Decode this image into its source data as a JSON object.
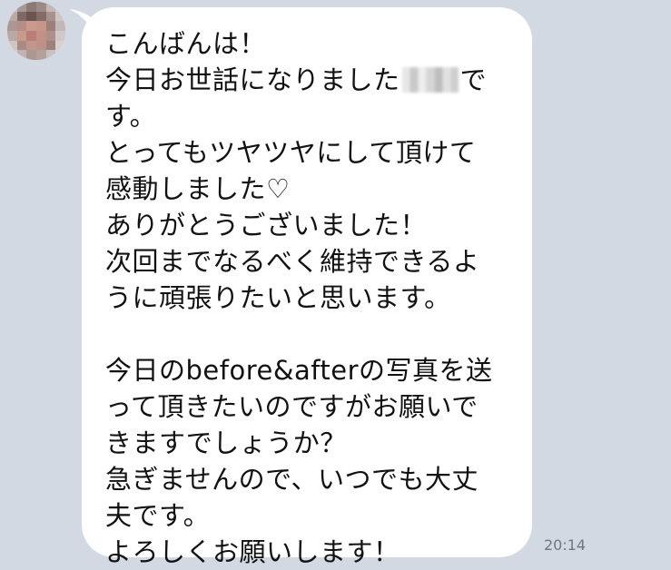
{
  "contact": {
    "avatar_icon": "pixelated-avatar-icon"
  },
  "message": {
    "lines": [
      "こんばんは！",
      "今日お世話になりました",
      "で",
      "す。",
      "とってもツヤツヤにして頂けて",
      "感動しました♡",
      "ありがとうございました！",
      "次回までなるべく維持できるよ",
      "うに頑張りたいと思います。",
      "",
      "今日のbefore&afterの写真を送",
      "って頂きたいのですがお願いで",
      "きますでしょうか？",
      "急ぎませんので、いつでも大丈",
      "夫です。",
      "よろしくお願いします！"
    ],
    "time": "20:14"
  },
  "colors": {
    "background": "#d3d9e2",
    "bubble": "#ffffff",
    "text": "#111111",
    "timestamp": "#6f7680"
  }
}
